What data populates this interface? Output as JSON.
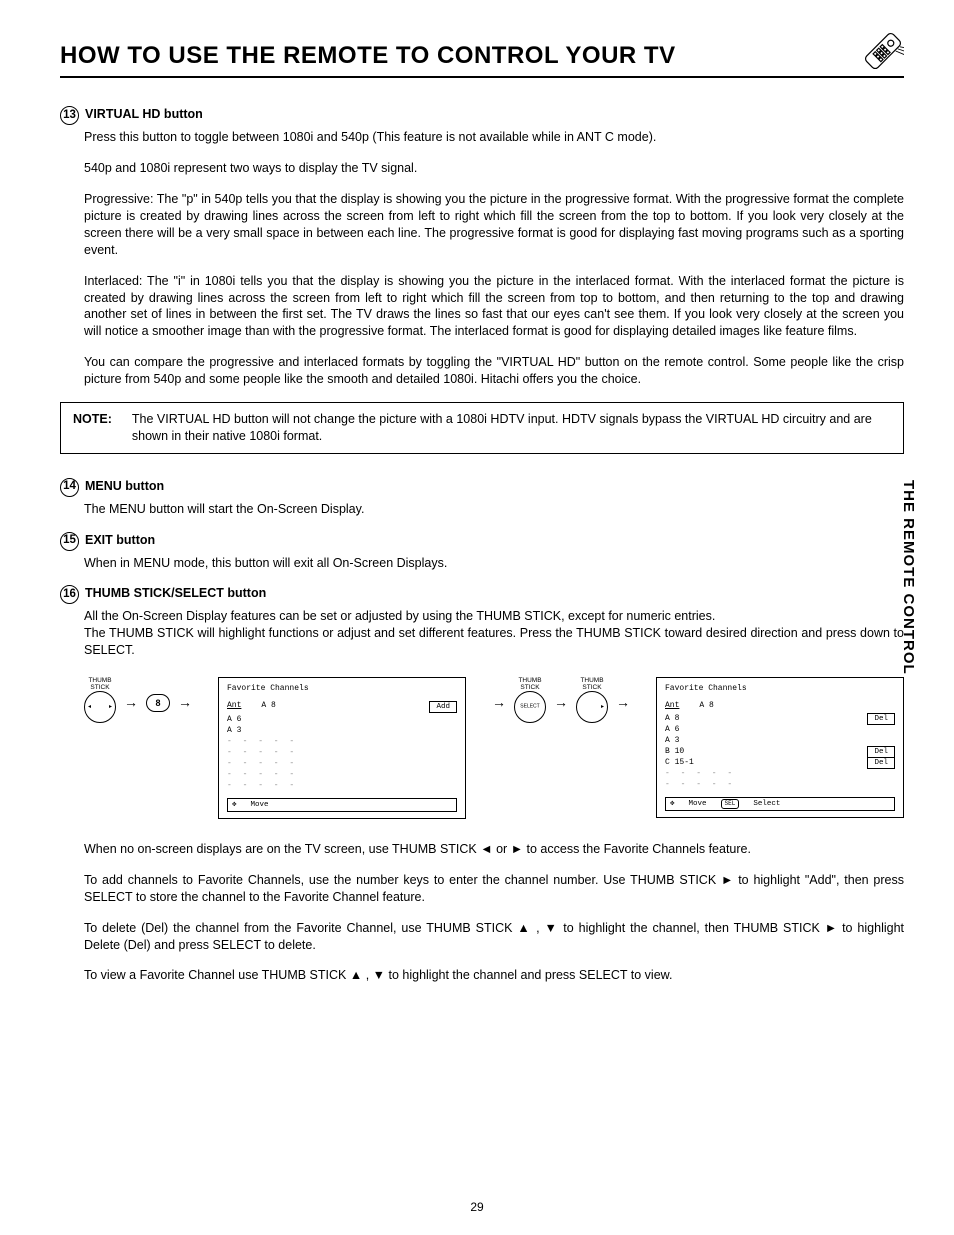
{
  "title": "HOW TO USE THE REMOTE TO CONTROL YOUR TV",
  "side_tab": "THE REMOTE CONTROL",
  "page_number": "29",
  "items": {
    "n13": {
      "num": "13",
      "title": "VIRTUAL HD button",
      "p1": "Press this button to toggle between 1080i and 540p (This feature is not available while in ANT C mode).",
      "p2": "540p and 1080i represent two ways to display the TV signal.",
      "p3": "Progressive: The \"p\" in 540p tells you that the display is showing you the picture in the progressive format. With the progressive format the complete picture is created by drawing lines across the screen from left to right which fill the screen from the top to bottom. If you look very closely at the screen there will be a very small space in between each line. The progressive format is good for displaying fast moving programs such as a sporting event.",
      "p4": "Interlaced: The \"i\" in 1080i tells you that the display is showing you the picture in the interlaced format. With the interlaced format the picture is created by drawing lines across the screen from left to right which fill the screen from top to bottom, and then returning to the top and drawing another set of lines in between the first set. The TV draws the lines so fast that our eyes can't see them. If you look very closely at the screen you will notice a smoother image than with the progressive format. The interlaced format is good for displaying detailed images like feature films.",
      "p5": "You can compare the progressive and interlaced formats by toggling the \"VIRTUAL HD\" button on the remote control. Some people like the crisp picture from 540p and some people like the smooth and detailed 1080i. Hitachi offers you the choice."
    },
    "note": {
      "label": "NOTE:",
      "text": "The VIRTUAL HD button will not change the picture with a 1080i HDTV input. HDTV signals bypass the VIRTUAL HD circuitry and are shown in their native 1080i format."
    },
    "n14": {
      "num": "14",
      "title": "MENU button",
      "body": "The MENU button will start the On-Screen Display."
    },
    "n15": {
      "num": "15",
      "title": "EXIT button",
      "body": "When in MENU mode, this button will exit all On-Screen Displays."
    },
    "n16": {
      "num": "16",
      "title": "THUMB STICK/SELECT button",
      "p1": "All the On-Screen Display features can be set or adjusted by using the THUMB STICK, except for numeric entries.",
      "p2": "The THUMB STICK will highlight functions or adjust and set different features.  Press the THUMB STICK toward desired direction and press down to SELECT."
    }
  },
  "diagram": {
    "thumb_label": "THUMB\nSTICK",
    "key8": "8",
    "select": "SELECT",
    "panel1": {
      "title": "Favorite Channels",
      "ant": "Ant",
      "ant_val": "A 8",
      "add": "Add",
      "rows": [
        "A 6",
        "A 3"
      ],
      "dashes": "- - - - -",
      "footer_move": "Move"
    },
    "panel2": {
      "title": "Favorite Channels",
      "ant": "Ant",
      "ant_val": "A 8",
      "rows": [
        {
          "ch": "A  8",
          "btn": "Del"
        },
        {
          "ch": "A  6",
          "btn": ""
        },
        {
          "ch": "A  3",
          "btn": ""
        },
        {
          "ch": "B  10",
          "btn": "Del"
        },
        {
          "ch": "C 15-1",
          "btn": "Del"
        }
      ],
      "dashes": "- - - - -",
      "footer_move": "Move",
      "footer_select": "Select",
      "footer_sel_label": "SEL"
    }
  },
  "body_paragraphs": {
    "p1a": "When no on-screen displays are on the TV screen, use THUMB STICK ",
    "p1b": " or ",
    "p1c": " to access the Favorite Channels feature.",
    "p2a": "To add channels to Favorite Channels, use the number keys to enter the channel number.  Use THUMB STICK ",
    "p2b": " to highlight \"Add\", then press SELECT to store the channel to the Favorite Channel feature.",
    "p3a": "To delete (Del) the channel from the Favorite Channel, use THUMB STICK ",
    "p3b": " , ",
    "p3c": " to highlight the channel, then THUMB STICK ",
    "p3d": " to highlight Delete (Del) and press SELECT to delete.",
    "p4a": "To view a Favorite Channel use THUMB STICK ",
    "p4b": " , ",
    "p4c": " to highlight the channel and press SELECT to view."
  },
  "glyphs": {
    "left": "◄",
    "right": "►",
    "up": "▲",
    "down": "▼",
    "cross": "✥"
  }
}
